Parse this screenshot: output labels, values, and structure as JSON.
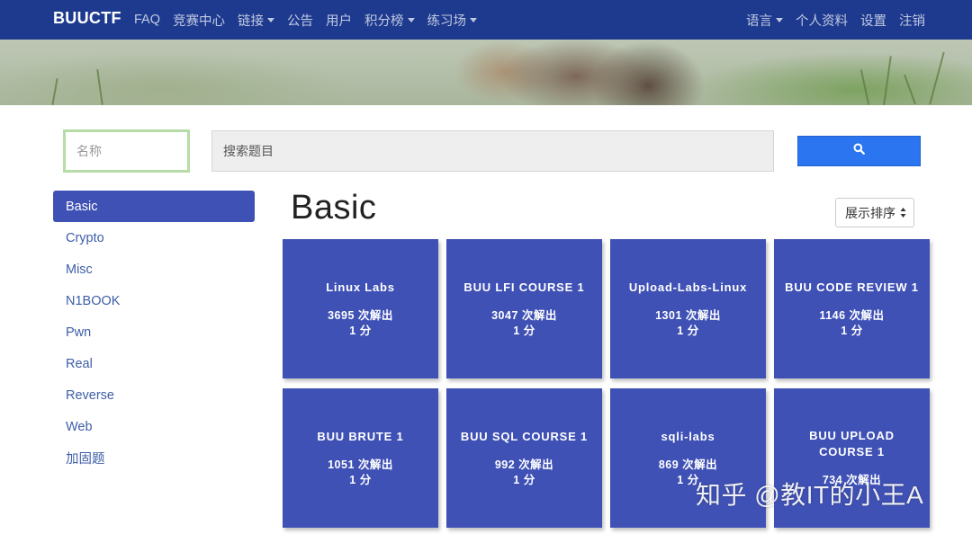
{
  "navbar": {
    "brand": "BUUCTF",
    "left_links": [
      {
        "label": "FAQ",
        "dropdown": false
      },
      {
        "label": "竞赛中心",
        "dropdown": false
      },
      {
        "label": "链接",
        "dropdown": true
      },
      {
        "label": "公告",
        "dropdown": false
      },
      {
        "label": "用户",
        "dropdown": false
      },
      {
        "label": "积分榜",
        "dropdown": true
      },
      {
        "label": "练习场",
        "dropdown": true
      }
    ],
    "right_links": [
      {
        "label": "语言",
        "dropdown": true
      },
      {
        "label": "个人资料",
        "dropdown": false
      },
      {
        "label": "设置",
        "dropdown": false
      },
      {
        "label": "注销",
        "dropdown": false
      }
    ]
  },
  "filters": {
    "name_placeholder": "名称",
    "search_placeholder": "搜索题目",
    "search_button_icon": "search-icon"
  },
  "sidebar": {
    "items": [
      {
        "label": "Basic",
        "active": true
      },
      {
        "label": "Crypto",
        "active": false
      },
      {
        "label": "Misc",
        "active": false
      },
      {
        "label": "N1BOOK",
        "active": false
      },
      {
        "label": "Pwn",
        "active": false
      },
      {
        "label": "Real",
        "active": false
      },
      {
        "label": "Reverse",
        "active": false
      },
      {
        "label": "Web",
        "active": false
      },
      {
        "label": "加固题",
        "active": false
      }
    ]
  },
  "main": {
    "category_title": "Basic",
    "sort_label": "展示排序"
  },
  "challenges": [
    {
      "title": "Linux Labs",
      "solves": "3695 次解出",
      "points": "1 分"
    },
    {
      "title": "BUU LFI COURSE 1",
      "solves": "3047 次解出",
      "points": "1 分"
    },
    {
      "title": "Upload-Labs-Linux",
      "solves": "1301 次解出",
      "points": "1 分"
    },
    {
      "title": "BUU CODE REVIEW 1",
      "solves": "1146 次解出",
      "points": "1 分"
    },
    {
      "title": "BUU BRUTE 1",
      "solves": "1051 次解出",
      "points": "1 分"
    },
    {
      "title": "BUU SQL COURSE 1",
      "solves": "992 次解出",
      "points": "1 分"
    },
    {
      "title": "sqli-labs",
      "solves": "869 次解出",
      "points": "1 分"
    },
    {
      "title": "BUU UPLOAD COURSE 1",
      "solves": "734 次解出",
      "points": ""
    }
  ],
  "watermark": "知乎 @教IT的小王A",
  "colors": {
    "navbar": "#1d3a8f",
    "accent": "#3f51b5",
    "search_button": "#2c75f0",
    "link": "#3e5ea8"
  }
}
